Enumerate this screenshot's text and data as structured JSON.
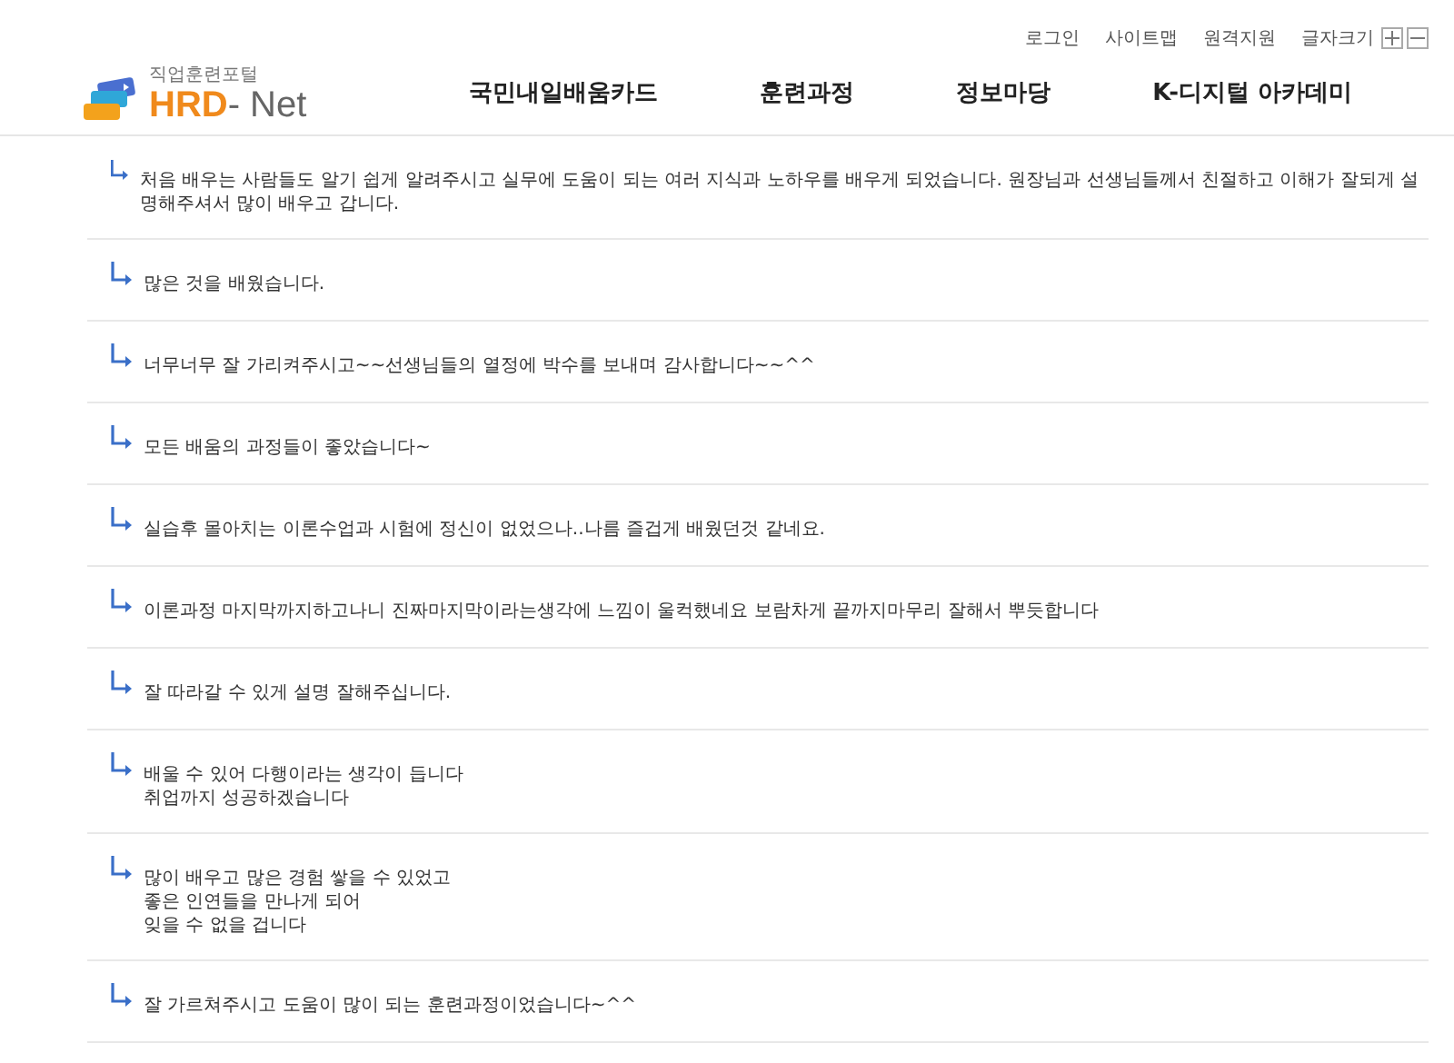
{
  "utility_links": [
    "로그인",
    "사이트맵",
    "원격지원"
  ],
  "font_size": {
    "label": "글자크기"
  },
  "logo": {
    "tagline": "직업훈련포털",
    "brand_first": "HRD",
    "brand_rest": "- Net"
  },
  "nav": [
    "국민내일배움카드",
    "훈련과정",
    "정보마당",
    "K-디지털 아카데미"
  ],
  "comments": [
    {
      "lines": [
        "처음 배우는 사람들도 알기 쉽게 알려주시고 실무에 도움이 되는 여러 지식과 노하우를 배우게 되었습니다. 원장님과 선생님들께서 친절하고 이해가 잘되게 설명해주셔서 많이 배우고 갑니다."
      ]
    },
    {
      "lines": [
        "많은 것을 배웠습니다."
      ]
    },
    {
      "lines": [
        "너무너무 잘 가리켜주시고~~선생님들의 열정에 박수를 보내며 감사합니다~~^^"
      ]
    },
    {
      "lines": [
        "모든 배움의 과정들이 좋았습니다~"
      ]
    },
    {
      "lines": [
        "실습후 몰아치는 이론수업과 시험에 정신이 없었으나..나름 즐겁게 배웠던것 같네요."
      ]
    },
    {
      "lines": [
        "이론과정 마지막까지하고나니 진짜마지막이라는생각에 느낌이 울컥했네요 보람차게 끝까지마무리 잘해서 뿌듯합니다"
      ]
    },
    {
      "lines": [
        "잘 따라갈 수 있게 설명 잘해주십니다."
      ]
    },
    {
      "lines": [
        "배울 수 있어 다행이라는 생각이 듭니다",
        "취업까지 성공하겠습니다"
      ]
    },
    {
      "lines": [
        "많이 배우고 많은 경험 쌓을 수 있었고",
        "좋은 인연들을 만나게 되어",
        "잊을 수 없을 겁니다"
      ]
    },
    {
      "lines": [
        "잘 가르쳐주시고 도움이 많이 되는 훈련과정이었습니다~^^"
      ]
    }
  ]
}
